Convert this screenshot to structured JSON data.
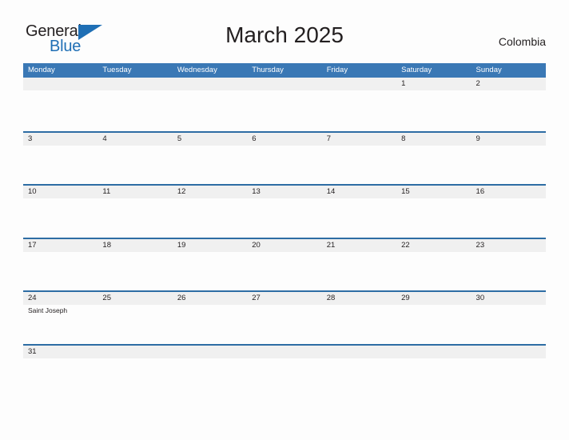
{
  "brand": {
    "name_part1": "General",
    "name_part2": "Blue",
    "triangle_icon": "triangle-icon",
    "accent_color": "#1f6fb5"
  },
  "header": {
    "title": "March 2025",
    "country": "Colombia"
  },
  "theme": {
    "header_blue": "#3a78b5",
    "rule_blue": "#2e6da4",
    "number_strip_gray": "#f0f0f0",
    "page_background": "#fdfdfd",
    "text_color": "#231f20"
  },
  "weekday_headers": [
    "Monday",
    "Tuesday",
    "Wednesday",
    "Thursday",
    "Friday",
    "Saturday",
    "Sunday"
  ],
  "weeks": [
    {
      "days": [
        {
          "number": "",
          "events": []
        },
        {
          "number": "",
          "events": []
        },
        {
          "number": "",
          "events": []
        },
        {
          "number": "",
          "events": []
        },
        {
          "number": "",
          "events": []
        },
        {
          "number": "1",
          "events": []
        },
        {
          "number": "2",
          "events": []
        }
      ]
    },
    {
      "days": [
        {
          "number": "3",
          "events": []
        },
        {
          "number": "4",
          "events": []
        },
        {
          "number": "5",
          "events": []
        },
        {
          "number": "6",
          "events": []
        },
        {
          "number": "7",
          "events": []
        },
        {
          "number": "8",
          "events": []
        },
        {
          "number": "9",
          "events": []
        }
      ]
    },
    {
      "days": [
        {
          "number": "10",
          "events": []
        },
        {
          "number": "11",
          "events": []
        },
        {
          "number": "12",
          "events": []
        },
        {
          "number": "13",
          "events": []
        },
        {
          "number": "14",
          "events": []
        },
        {
          "number": "15",
          "events": []
        },
        {
          "number": "16",
          "events": []
        }
      ]
    },
    {
      "days": [
        {
          "number": "17",
          "events": []
        },
        {
          "number": "18",
          "events": []
        },
        {
          "number": "19",
          "events": []
        },
        {
          "number": "20",
          "events": []
        },
        {
          "number": "21",
          "events": []
        },
        {
          "number": "22",
          "events": []
        },
        {
          "number": "23",
          "events": []
        }
      ]
    },
    {
      "days": [
        {
          "number": "24",
          "events": [
            "Saint Joseph"
          ]
        },
        {
          "number": "25",
          "events": []
        },
        {
          "number": "26",
          "events": []
        },
        {
          "number": "27",
          "events": []
        },
        {
          "number": "28",
          "events": []
        },
        {
          "number": "29",
          "events": []
        },
        {
          "number": "30",
          "events": []
        }
      ]
    },
    {
      "last": true,
      "days": [
        {
          "number": "31",
          "events": []
        },
        {
          "number": "",
          "events": []
        },
        {
          "number": "",
          "events": []
        },
        {
          "number": "",
          "events": []
        },
        {
          "number": "",
          "events": []
        },
        {
          "number": "",
          "events": []
        },
        {
          "number": "",
          "events": []
        }
      ]
    }
  ]
}
